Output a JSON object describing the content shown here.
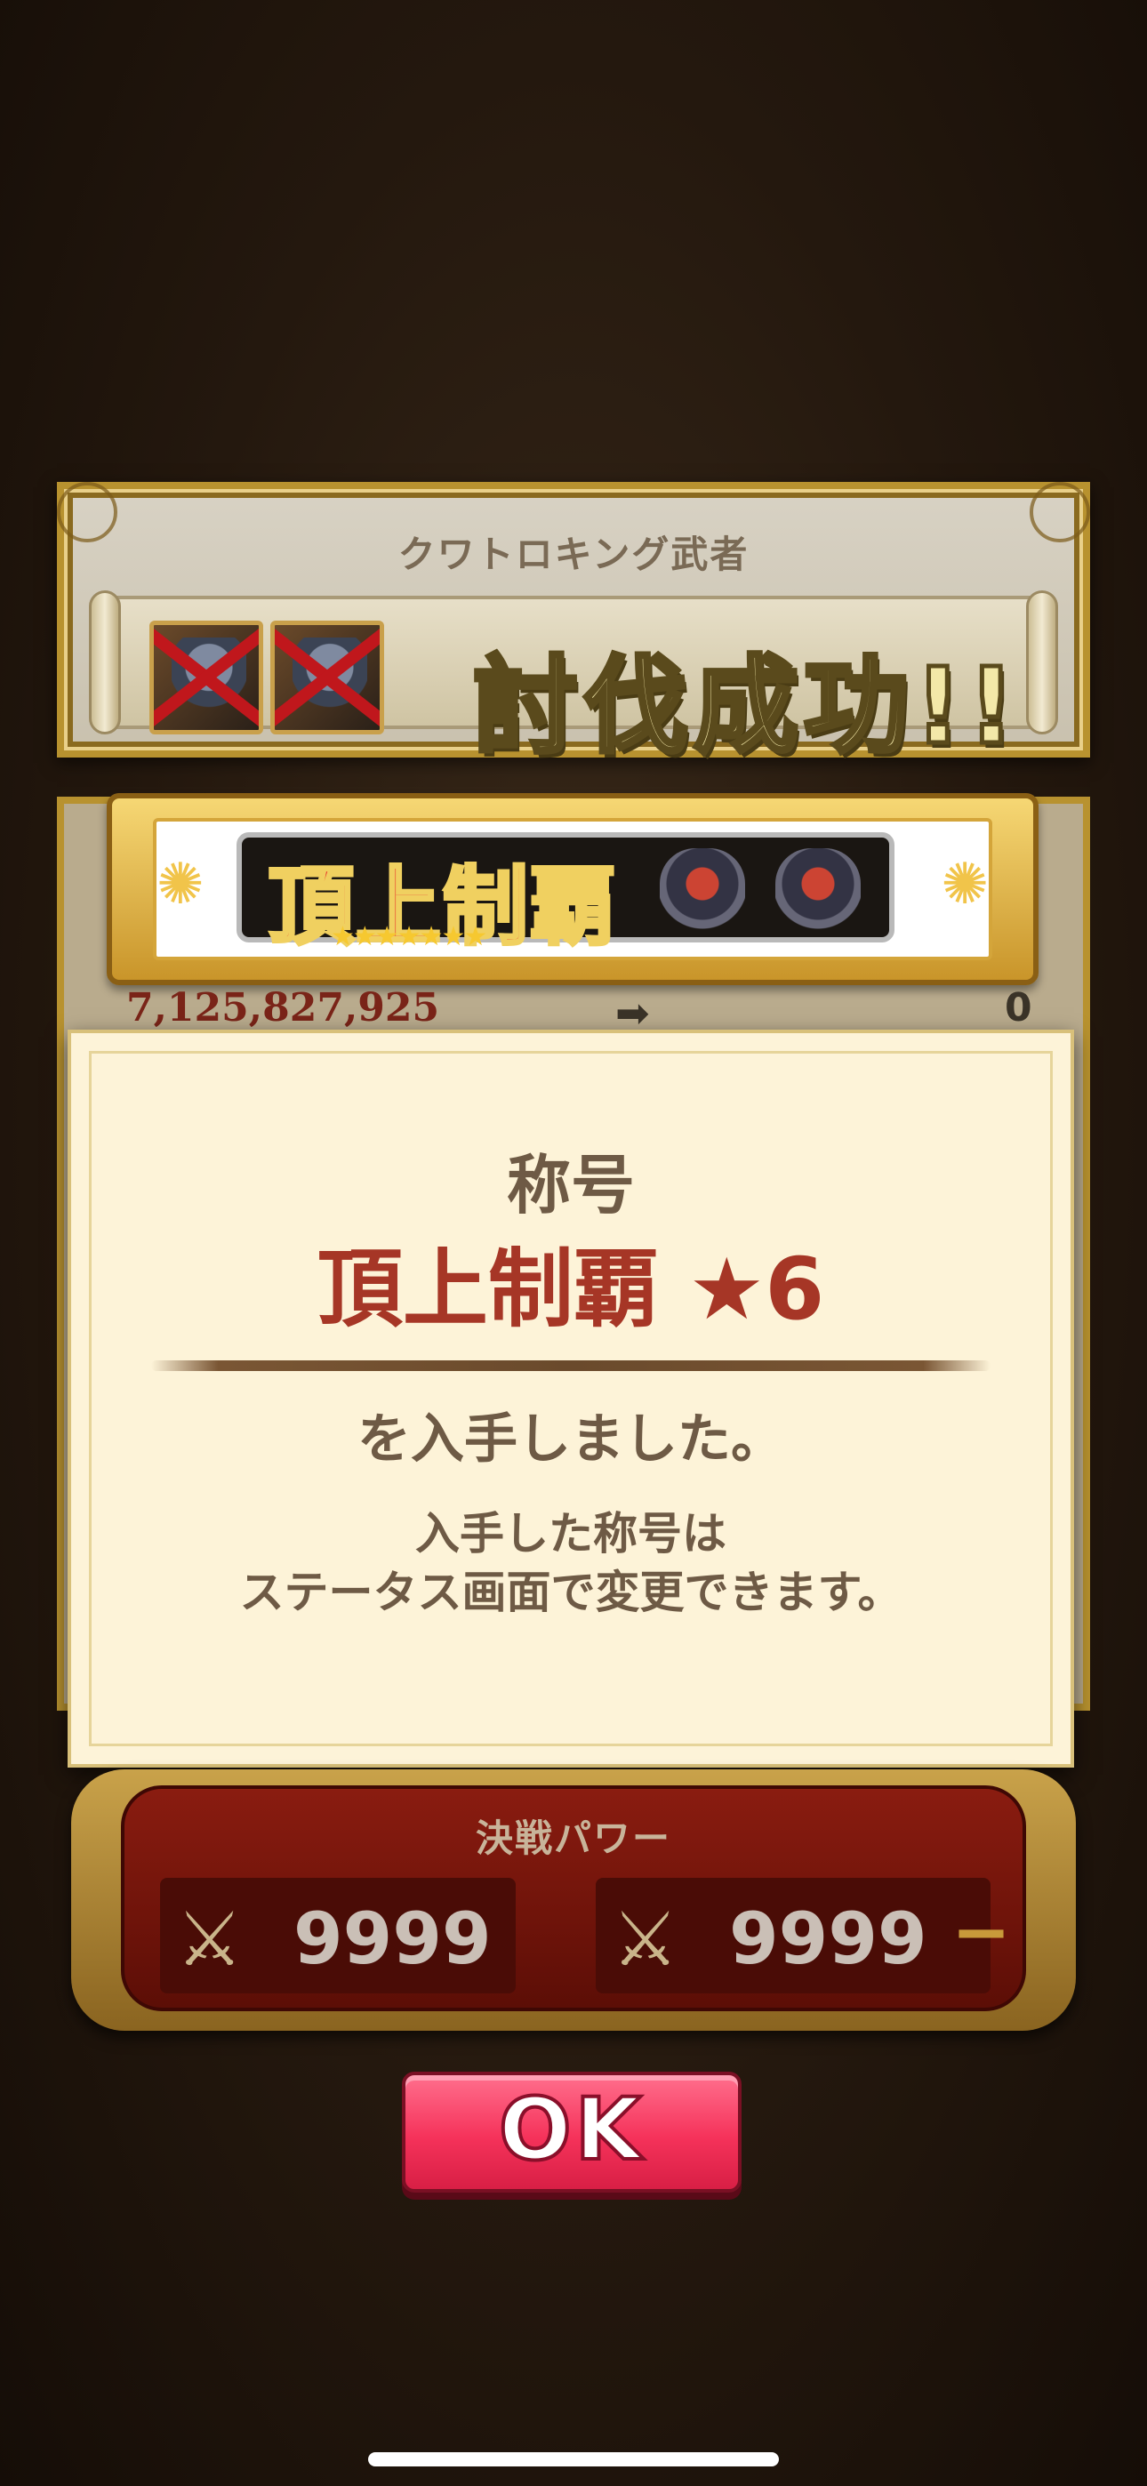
{
  "result": {
    "boss_name": "クワトロキング武者",
    "defeated_icons": [
      "samurai-boss-portrait",
      "samurai-boss-portrait"
    ],
    "success_text": "討伐成功!!"
  },
  "title_banner": {
    "title_art": "頂上制覇",
    "stars": "★★★★★★★"
  },
  "score": {
    "before": "7,125,827,925",
    "arrow": "➡",
    "after": "0"
  },
  "dialog": {
    "label": "称号",
    "title": "頂上制覇 ★6",
    "acquired": "を入手しました。",
    "note_line1": "入手した称号は",
    "note_line2": "ステータス画面で変更できます。"
  },
  "power": {
    "title": "決戦パワー",
    "before": "9999",
    "after": "9999",
    "change": "−"
  },
  "ok_button": {
    "label": "OK"
  },
  "colors": {
    "title_red": "#a63626",
    "ok_pink": "#f5325a",
    "panel_gold": "#b8922f",
    "dialog_bg": "#fdf3d8"
  }
}
